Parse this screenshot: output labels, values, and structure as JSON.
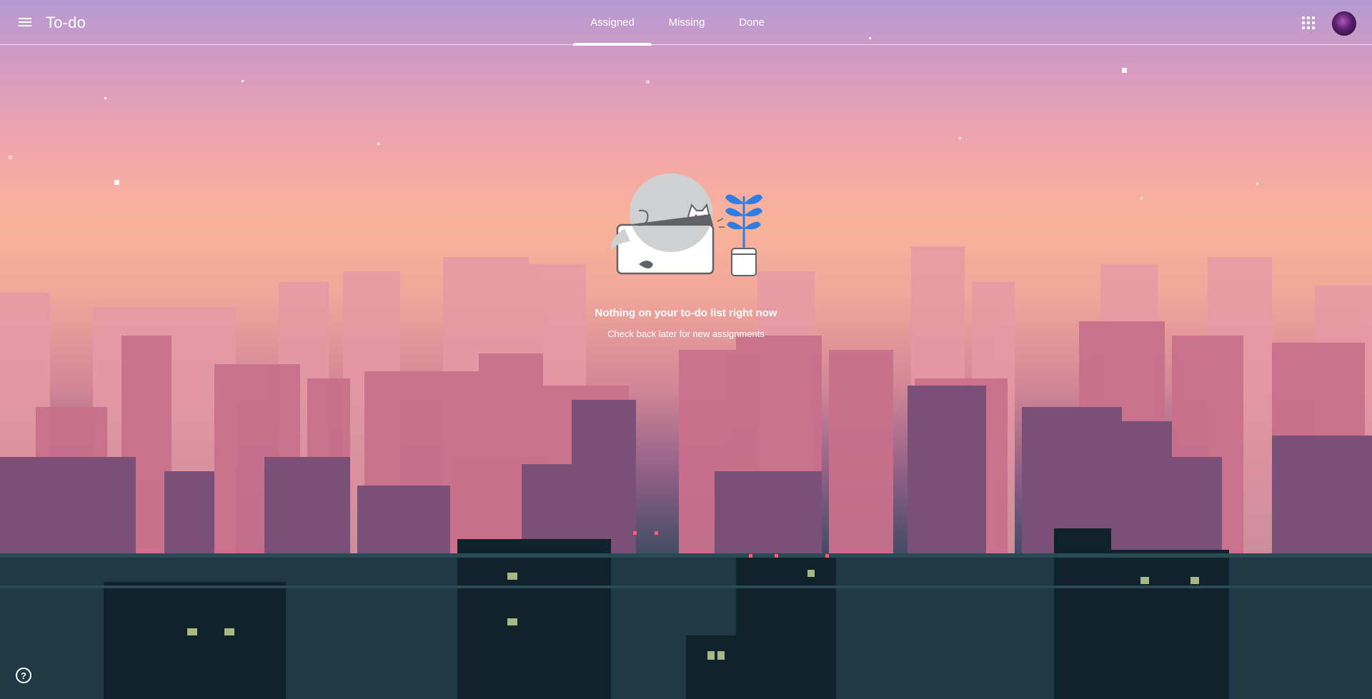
{
  "app": {
    "title": "To-do"
  },
  "tabs": [
    {
      "label": "Assigned",
      "active": true
    },
    {
      "label": "Missing",
      "active": false
    },
    {
      "label": "Done",
      "active": false
    }
  ],
  "icons": {
    "menu": "menu-icon",
    "apps": "apps-grid-icon",
    "avatar": "account-avatar",
    "help": "help-icon"
  },
  "help": {
    "glyph": "?"
  },
  "empty_state": {
    "title": "Nothing on your to-do list right now",
    "subtitle": "Check back later for new assignments"
  },
  "colors": {
    "accent_plant": "#2f7de1",
    "text": "#ffffff"
  }
}
